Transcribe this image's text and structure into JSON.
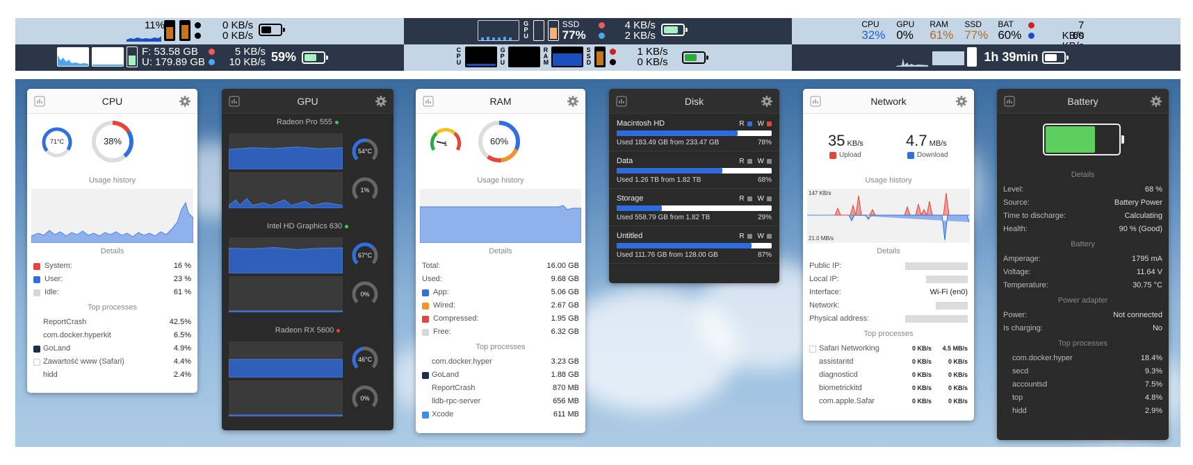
{
  "menubar": {
    "row1": {
      "s1": {
        "cpu_pct": "11%",
        "net_up": "0 KB/s",
        "net_down": "0 KB/s"
      },
      "s2": {
        "gpu_label": "GPU",
        "ssd_label": "SSD",
        "ssd_pct": "77%",
        "net_up": "4 KB/s",
        "net_down": "2 KB/s"
      },
      "s3": {
        "labels": [
          "CPU",
          "GPU",
          "RAM",
          "SSD",
          "BAT"
        ],
        "values": [
          "32%",
          "0%",
          "61%",
          "77%",
          "60%"
        ],
        "colors": [
          "#1a5fd6",
          "#000000",
          "#b36a1f",
          "#b36a1f",
          "#000000"
        ],
        "net_up": "7 KB/s",
        "net_down": "60 KB/s"
      }
    },
    "row2": {
      "s1": {
        "free": "F:  53.58 GB",
        "used": "U: 179.89 GB",
        "net_up": "5 KB/s",
        "net_down": "10 KB/s",
        "battery": "59%"
      },
      "s2": {
        "cpu": "CPU",
        "gpu": "GPU",
        "ram": "RAM",
        "ssd": "SSD",
        "net_up": "1 KB/s",
        "net_down": "0 KB/s"
      },
      "s3": {
        "time": "1h 39min"
      }
    }
  },
  "cpu": {
    "title": "CPU",
    "temp": "71°C",
    "usage": "38%",
    "usage_frac": 0.38,
    "history_label": "Usage history",
    "details_label": "Details",
    "details": [
      {
        "k": "System:",
        "v": "16 %",
        "c": "#e5453a"
      },
      {
        "k": "User:",
        "v": "23 %",
        "c": "#2f6fde"
      },
      {
        "k": "Idle:",
        "v": "61 %",
        "c": "#d6d6d6"
      }
    ],
    "top_label": "Top processes",
    "processes": [
      {
        "n": "ReportCrash",
        "v": "42.5%"
      },
      {
        "n": "com.docker.hyperkit",
        "v": "6.5%"
      },
      {
        "n": "GoLand",
        "v": "4.9%"
      },
      {
        "n": "Zawartość www (Safari)",
        "v": "4.4%"
      },
      {
        "n": "hidd",
        "v": "2.4%"
      }
    ]
  },
  "gpu": {
    "title": "GPU",
    "cards": [
      {
        "name": "Radeon Pro 555",
        "status": "#3ccf4e",
        "temp": "54°C",
        "usage": "1%"
      },
      {
        "name": "Intel HD Graphics 630",
        "status": "#3ccf4e",
        "temp": "67°C",
        "usage": "0%"
      },
      {
        "name": "Radeon RX 5600",
        "status": "#e5453a",
        "temp": "46°C",
        "usage": "0%"
      }
    ]
  },
  "ram": {
    "title": "RAM",
    "pressure": "1",
    "usage": "60%",
    "usage_frac": 0.6,
    "history_label": "Usage history",
    "details_label": "Details",
    "details": [
      {
        "k": "Total:",
        "v": "16.00 GB",
        "c": ""
      },
      {
        "k": "Used:",
        "v": "9.68 GB",
        "c": ""
      },
      {
        "k": "App:",
        "v": "5.06 GB",
        "c": "#2f6fde"
      },
      {
        "k": "Wired:",
        "v": "2.67 GB",
        "c": "#f0952b"
      },
      {
        "k": "Compressed:",
        "v": "1.95 GB",
        "c": "#e5453a"
      },
      {
        "k": "Free:",
        "v": "6.32 GB",
        "c": "#d6d6d6"
      }
    ],
    "top_label": "Top processes",
    "processes": [
      {
        "n": "com.docker.hyper",
        "v": "3.23 GB"
      },
      {
        "n": "GoLand",
        "v": "1.88 GB"
      },
      {
        "n": "ReportCrash",
        "v": "870 MB"
      },
      {
        "n": "lldb-rpc-server",
        "v": "656 MB"
      },
      {
        "n": "Xcode",
        "v": "611 MB"
      }
    ]
  },
  "disk": {
    "title": "Disk",
    "disks": [
      {
        "name": "Macintosh HD",
        "used": "Used 183.49 GB from 233.47 GB",
        "pct": "78%",
        "frac": 0.78,
        "r": "#2f6fde",
        "w": "#e5453a"
      },
      {
        "name": "Data",
        "used": "Used 1.26 TB from 1.82 TB",
        "pct": "68%",
        "frac": 0.68,
        "r": "#888888",
        "w": "#888888"
      },
      {
        "name": "Storage",
        "used": "Used 558.79 GB from 1.82 TB",
        "pct": "29%",
        "frac": 0.29,
        "r": "#888888",
        "w": "#888888"
      },
      {
        "name": "Untitled",
        "used": "Used 111.76 GB from 128.00 GB",
        "pct": "87%",
        "frac": 0.87,
        "r": "#888888",
        "w": "#888888"
      }
    ]
  },
  "network": {
    "title": "Network",
    "upload_value": "35",
    "upload_unit": "KB/s",
    "upload_label": "Upload",
    "download_value": "4.7",
    "download_unit": "MB/s",
    "download_label": "Download",
    "history_label": "Usage history",
    "scale_top": "147 KB/s",
    "scale_bottom": "21.0 MB/s",
    "details_label": "Details",
    "details": [
      {
        "k": "Public IP:",
        "v": ""
      },
      {
        "k": "Local IP:",
        "v": ""
      },
      {
        "k": "Interface:",
        "v": "Wi-Fi (en0)"
      },
      {
        "k": "Network:",
        "v": ""
      },
      {
        "k": "Physical address:",
        "v": ""
      }
    ],
    "top_label": "Top processes",
    "processes": [
      {
        "n": "Safari Networking",
        "a": "0 KB/s",
        "b": "4.5 MB/s"
      },
      {
        "n": "assistantd",
        "a": "0 KB/s",
        "b": "0 KB/s"
      },
      {
        "n": "diagnosticd",
        "a": "0 KB/s",
        "b": "0 KB/s"
      },
      {
        "n": "biometrickitd",
        "a": "0 KB/s",
        "b": "0 KB/s"
      },
      {
        "n": "com.apple.Safar",
        "a": "0 KB/s",
        "b": "0 KB/s"
      }
    ]
  },
  "battery": {
    "title": "Battery",
    "level_frac": 0.68,
    "details_label": "Details",
    "details": [
      {
        "k": "Level:",
        "v": "68 %"
      },
      {
        "k": "Source:",
        "v": "Battery Power"
      },
      {
        "k": "Time to discharge:",
        "v": "Calculating"
      },
      {
        "k": "Health:",
        "v": "90 % (Good)"
      }
    ],
    "battery_label": "Battery",
    "battery_rows": [
      {
        "k": "Amperage:",
        "v": "1795 mA"
      },
      {
        "k": "Voltage:",
        "v": "11.64 V"
      },
      {
        "k": "Temperature:",
        "v": "30.75 °C"
      }
    ],
    "adapter_label": "Power adapter",
    "adapter_rows": [
      {
        "k": "Power:",
        "v": "Not connected"
      },
      {
        "k": "Is charging:",
        "v": "No"
      }
    ],
    "top_label": "Top processes",
    "processes": [
      {
        "n": "com.docker.hyper",
        "v": "18.4%"
      },
      {
        "n": "secd",
        "v": "9.3%"
      },
      {
        "n": "accountsd",
        "v": "7.5%"
      },
      {
        "n": "top",
        "v": "4.8%"
      },
      {
        "n": "hidd",
        "v": "2.9%"
      }
    ]
  }
}
